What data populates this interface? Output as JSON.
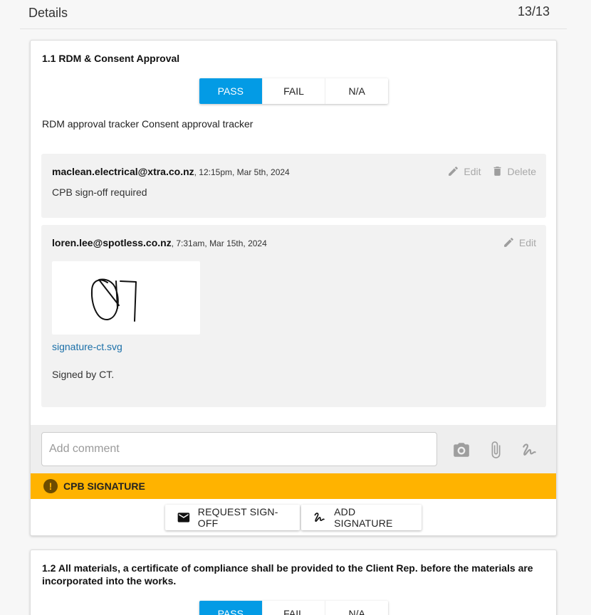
{
  "header": {
    "title": "Details",
    "count": "13/13"
  },
  "items": [
    {
      "title": "1.1 RDM & Consent Approval",
      "options": [
        "PASS",
        "FAIL",
        "N/A"
      ],
      "selected": "PASS",
      "description": "RDM approval tracker Consent approval tracker",
      "comments": [
        {
          "author": "maclean.electrical@xtra.co.nz",
          "time": ", 12:15pm, Mar 5th, 2024",
          "body": "CPB sign-off required",
          "edit_label": "Edit",
          "delete_label": "Delete"
        },
        {
          "author": "loren.lee@spotless.co.nz",
          "time": ", 7:31am, Mar 15th, 2024",
          "edit_label": "Edit",
          "attachment": "signature-ct.svg",
          "body": "Signed by CT."
        }
      ],
      "comment_placeholder": "Add comment",
      "alert": "CPB SIGNATURE",
      "buttons": {
        "request": "REQUEST SIGN-OFF",
        "sign": "ADD SIGNATURE"
      }
    },
    {
      "title": "1.2 All materials, a certificate of compliance shall be provided to the Client Rep. before the materials are incorporated into the works.",
      "options": [
        "PASS",
        "FAIL",
        "N/A"
      ],
      "selected": "PASS"
    }
  ],
  "colors": {
    "accent": "#039be5",
    "alert": "#ffb300",
    "link": "#1a6fa8"
  },
  "icons": [
    "pencil-icon",
    "trash-icon",
    "camera-icon",
    "paperclip-icon",
    "signature-icon",
    "mail-icon",
    "alert-icon"
  ]
}
